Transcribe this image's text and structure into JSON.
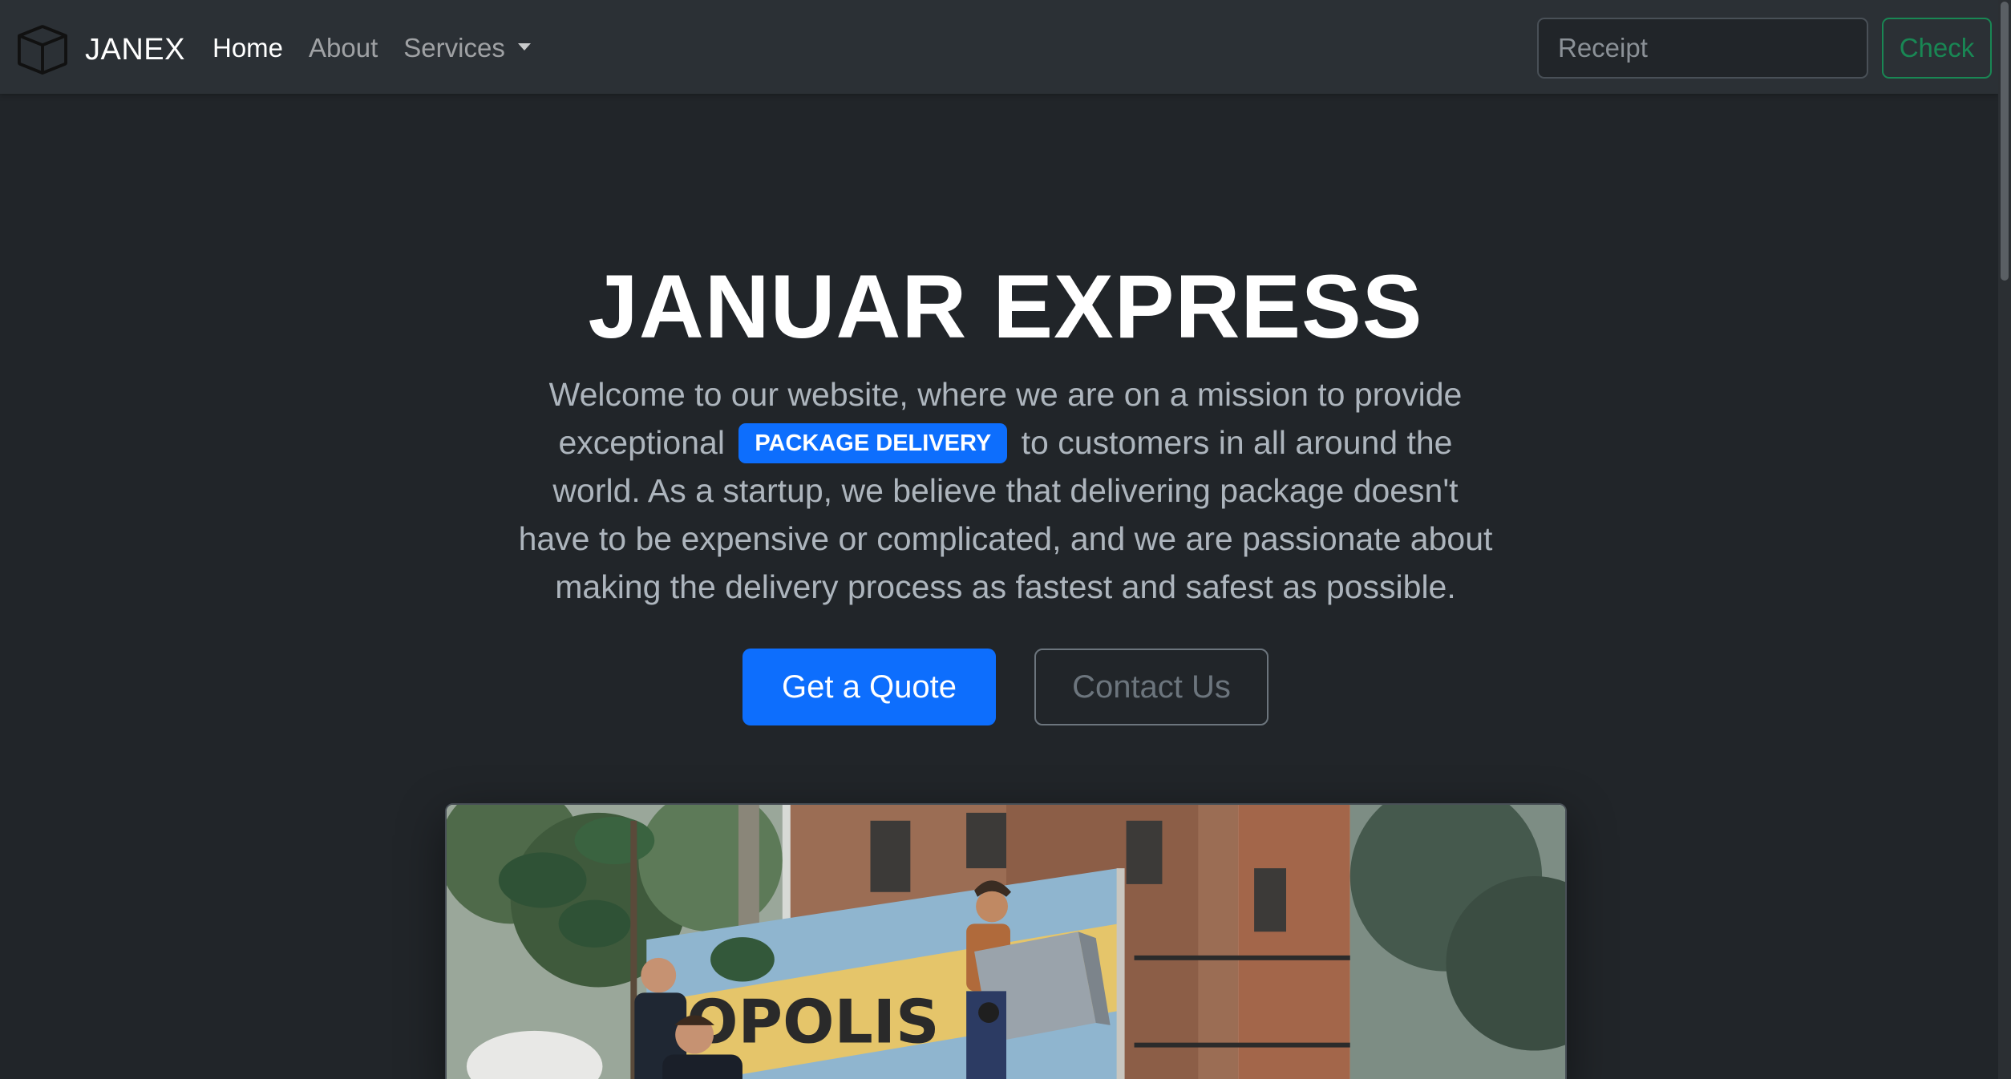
{
  "navbar": {
    "brand_icon": "package-box-icon",
    "brand": "JANEX",
    "links": [
      {
        "label": "Home",
        "active": true
      },
      {
        "label": "About",
        "active": false
      },
      {
        "label": "Services",
        "active": false,
        "dropdown": true
      }
    ],
    "search_placeholder": "Receipt",
    "check_label": "Check",
    "colors": {
      "background": "#2b3035",
      "check_accent": "#198754"
    }
  },
  "hero": {
    "title": "JANUAR EXPRESS",
    "lead_before": "Welcome to our website, where we are on a mission to provide exceptional",
    "badge": "PACKAGE DELIVERY",
    "lead_after": "to customers in all around the world. As a startup, we believe that delivering package doesn't have to be expensive or complicated, and we are passionate about making the delivery process as fastest and safest as possible.",
    "primary_button": "Get a Quote",
    "secondary_button": "Contact Us",
    "image_truck_text": "OPOLIS",
    "colors": {
      "primary": "#0d6efd",
      "background": "#212529"
    }
  }
}
